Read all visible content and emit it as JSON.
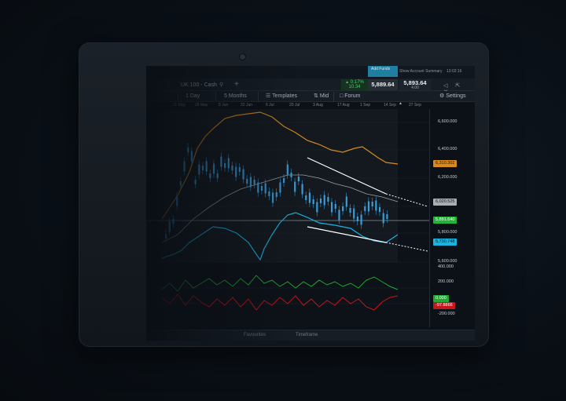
{
  "header": {
    "add_funds": "Add Funds",
    "account_summary": "Show Account Summary",
    "clock": "13:02:16"
  },
  "instrument": {
    "name": "UK 100 - Cash",
    "change_pct": "0.17%",
    "change_pts": "10.34",
    "sell_price": "5,889.64",
    "buy_price": "5,893.64",
    "spread": "4.00"
  },
  "toolbar": {
    "interval": "1 Day",
    "range": "5 Months",
    "templates": "Templates",
    "price_type": "Mid",
    "forum": "Forum",
    "settings": "Settings"
  },
  "dates": [
    "11 May",
    "26 May",
    "8 Jun",
    "22 Jun",
    "6 Jul",
    "20 Jul",
    "3 Aug",
    "17 Aug",
    "1 Sep",
    "14 Sep",
    "27 Sep"
  ],
  "price_axis": {
    "ticks": [
      "6,600.000",
      "6,400.000",
      "6,200.000",
      "5,800.000",
      "5,600.000"
    ],
    "tags": {
      "upper_band": "6,310.302",
      "middle_band": "6,020.525",
      "last_price": "5,891.640",
      "lower_band": "5,730.748"
    }
  },
  "oscillator_axis": {
    "ticks": [
      "400.000",
      "200.000",
      "-200.000"
    ],
    "tags": {
      "green": "0.000",
      "red": "-97.8866"
    }
  },
  "footer": {
    "favourites": "Favourites",
    "timeframe": "Timeframe"
  },
  "colors": {
    "candles": "#3a9bd8",
    "upper_band": "#d98a1e",
    "lower_band": "#19b5e0",
    "middle_band": "#9aa2a8",
    "last_price": "#22b33a",
    "osc_green": "#22a832",
    "osc_red": "#c4161c",
    "add_funds": "#1f7fa3"
  },
  "icons": [
    "search-icon",
    "plus-icon",
    "templates-icon",
    "mid-icon",
    "forum-icon",
    "settings-icon",
    "bell-icon"
  ]
}
